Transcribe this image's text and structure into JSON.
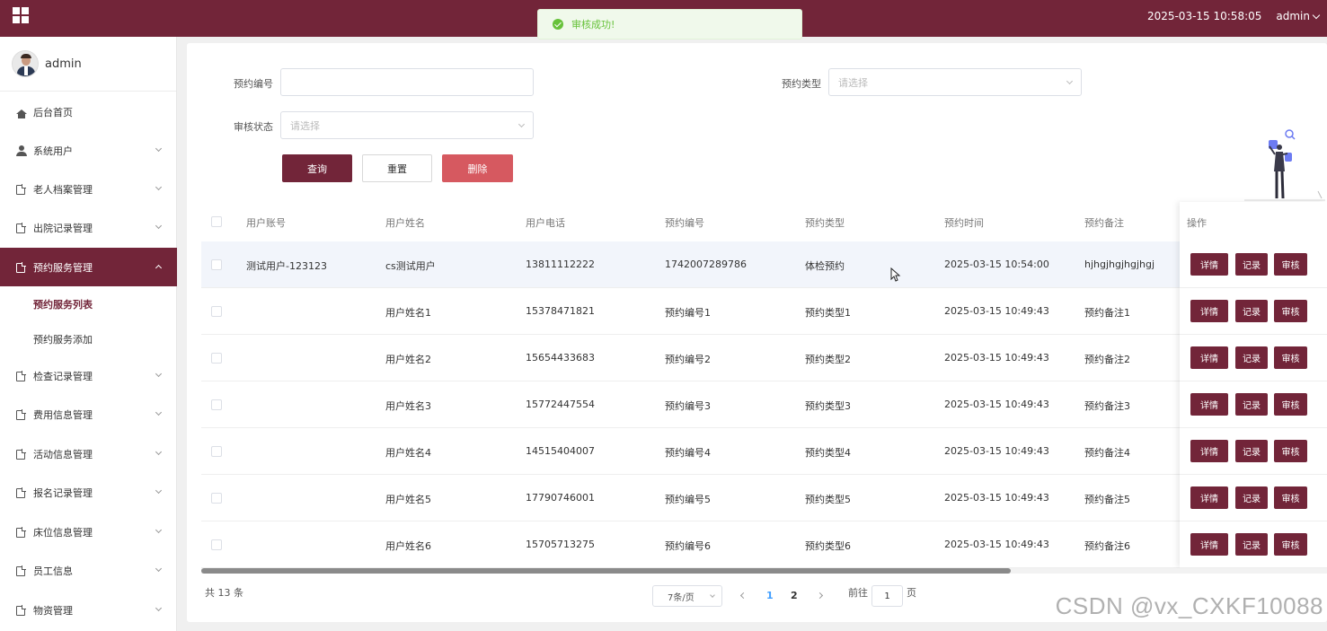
{
  "topbar": {
    "datetime": "2025-03-15 10:58:05",
    "user": "admin"
  },
  "toast": {
    "message": "审核成功!"
  },
  "sidebar": {
    "profile_name": "admin",
    "items": [
      {
        "label": "后台首页"
      },
      {
        "label": "系统用户"
      },
      {
        "label": "老人档案管理"
      },
      {
        "label": "出院记录管理"
      },
      {
        "label": "预约服务管理"
      },
      {
        "label": "检查记录管理"
      },
      {
        "label": "费用信息管理"
      },
      {
        "label": "活动信息管理"
      },
      {
        "label": "报名记录管理"
      },
      {
        "label": "床位信息管理"
      },
      {
        "label": "员工信息"
      },
      {
        "label": "物资管理"
      }
    ],
    "subitems": [
      {
        "label": "预约服务列表"
      },
      {
        "label": "预约服务添加"
      }
    ]
  },
  "search": {
    "booking_no_label": "预约编号",
    "booking_no_value": "",
    "booking_type_label": "预约类型",
    "booking_type_placeholder": "请选择",
    "audit_status_label": "审核状态",
    "audit_status_placeholder": "请选择",
    "query_label": "查询",
    "reset_label": "重置",
    "delete_label": "删除"
  },
  "table": {
    "columns": [
      "用户账号",
      "用户姓名",
      "用户电话",
      "预约编号",
      "预约类型",
      "预约时间",
      "预约备注"
    ],
    "op_column": "操作",
    "rows": [
      [
        "测试用户-123123",
        "cs测试用户",
        "13811112222",
        "1742007289786",
        "体检预约",
        "2025-03-15 10:54:00",
        "hjhgjhgjhgjhgj"
      ],
      [
        "",
        "用户姓名1",
        "15378471821",
        "预约编号1",
        "预约类型1",
        "2025-03-15 10:49:43",
        "预约备注1"
      ],
      [
        "",
        "用户姓名2",
        "15654433683",
        "预约编号2",
        "预约类型2",
        "2025-03-15 10:49:43",
        "预约备注2"
      ],
      [
        "",
        "用户姓名3",
        "15772447554",
        "预约编号3",
        "预约类型3",
        "2025-03-15 10:49:43",
        "预约备注3"
      ],
      [
        "",
        "用户姓名4",
        "14515404007",
        "预约编号4",
        "预约类型4",
        "2025-03-15 10:49:43",
        "预约备注4"
      ],
      [
        "",
        "用户姓名5",
        "17790746001",
        "预约编号5",
        "预约类型5",
        "2025-03-15 10:49:43",
        "预约备注5"
      ],
      [
        "",
        "用户姓名6",
        "15705713275",
        "预约编号6",
        "预约类型6",
        "2025-03-15 10:49:43",
        "预约备注6"
      ]
    ],
    "op_buttons": [
      "详情",
      "记录",
      "审核"
    ]
  },
  "pagination": {
    "total": "共 13 条",
    "page_size": "7条/页",
    "pages": [
      "1",
      "2"
    ],
    "goto_prefix": "前往",
    "goto_value": "1",
    "goto_suffix": "页"
  },
  "watermark": "CSDN @vx_CXKF10088",
  "colors": {
    "brand": "#722539",
    "danger": "#d65960",
    "success": "#67c23a"
  }
}
